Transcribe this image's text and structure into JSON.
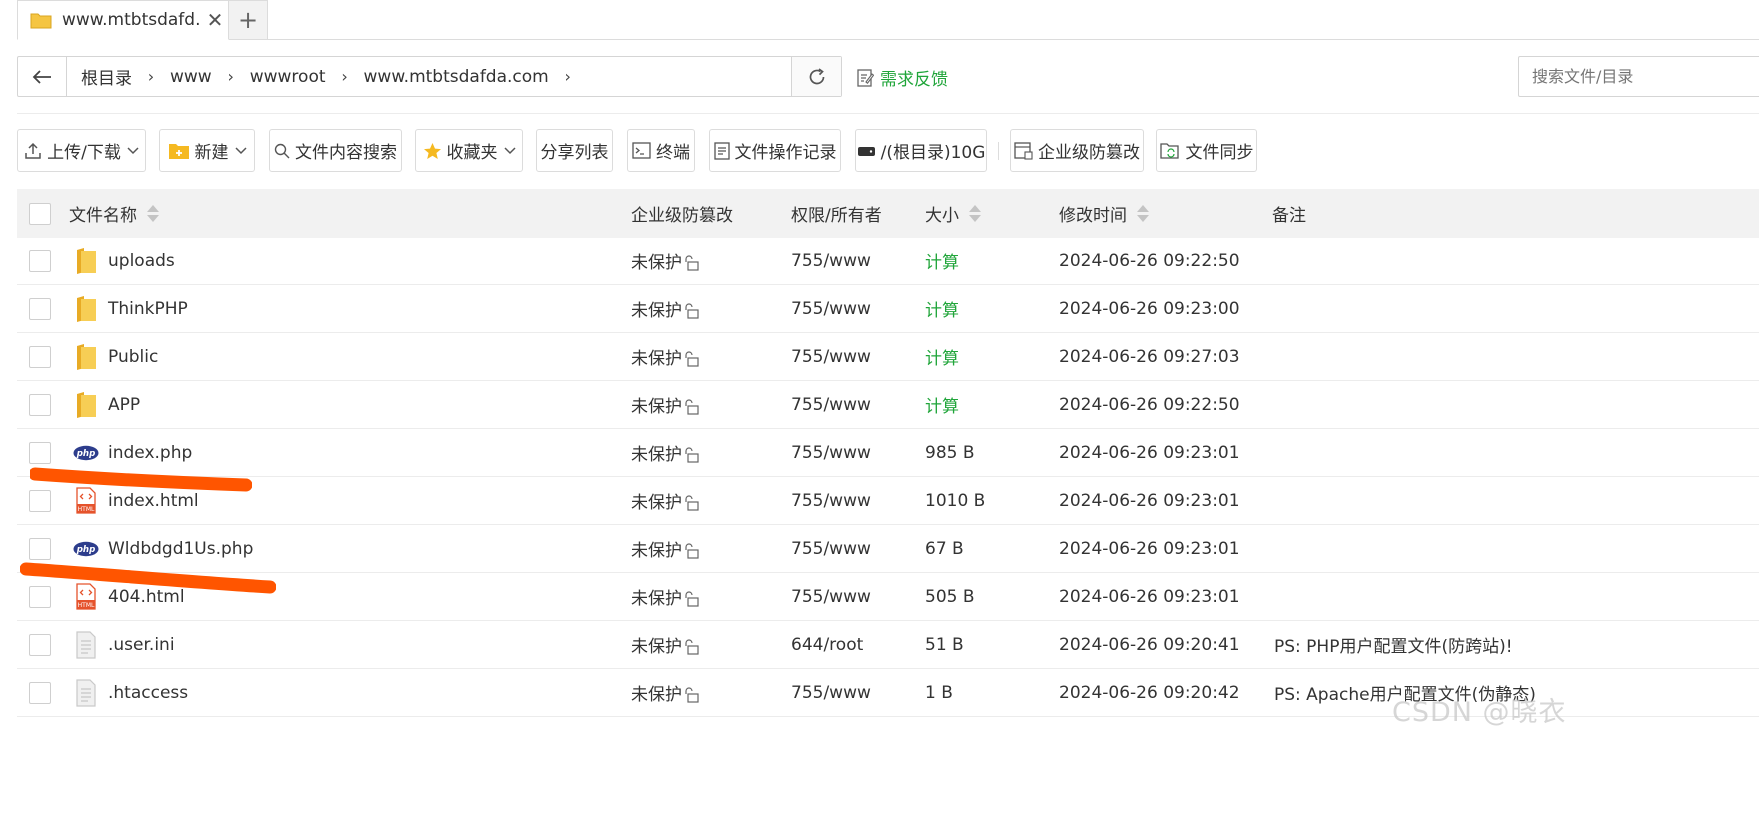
{
  "tab": {
    "title": "www.mtbtsdafd...",
    "close": "✕",
    "add": "+"
  },
  "address": {
    "crumbs": [
      "根目录",
      "www",
      "wwwroot",
      "www.mtbtsdafda.com"
    ],
    "separator": "›"
  },
  "feedback": {
    "label": "需求反馈"
  },
  "search": {
    "placeholder": "搜索文件/目录"
  },
  "toolbar": {
    "upload": "上传/下载",
    "new": "新建",
    "content_search": "文件内容搜索",
    "favorites": "收藏夹",
    "share_list": "分享列表",
    "terminal": "终端",
    "op_log": "文件操作记录",
    "disk": "/(根目录)10G",
    "tamper": "企业级防篡改",
    "sync": "文件同步"
  },
  "table": {
    "headers": {
      "name": "文件名称",
      "tamper": "企业级防篡改",
      "perm": "权限/所有者",
      "size": "大小",
      "mtime": "修改时间",
      "note": "备注"
    },
    "rows": [
      {
        "type": "folder",
        "name": "uploads",
        "protect": "未保护",
        "perm": "755/www",
        "size": "计算",
        "mtime": "2024-06-26 09:22:50",
        "note": ""
      },
      {
        "type": "folder",
        "name": "ThinkPHP",
        "protect": "未保护",
        "perm": "755/www",
        "size": "计算",
        "mtime": "2024-06-26 09:23:00",
        "note": ""
      },
      {
        "type": "folder",
        "name": "Public",
        "protect": "未保护",
        "perm": "755/www",
        "size": "计算",
        "mtime": "2024-06-26 09:27:03",
        "note": ""
      },
      {
        "type": "folder",
        "name": "APP",
        "protect": "未保护",
        "perm": "755/www",
        "size": "计算",
        "mtime": "2024-06-26 09:22:50",
        "note": ""
      },
      {
        "type": "php",
        "name": "index.php",
        "protect": "未保护",
        "perm": "755/www",
        "size": "985 B",
        "mtime": "2024-06-26 09:23:01",
        "note": ""
      },
      {
        "type": "html",
        "name": "index.html",
        "protect": "未保护",
        "perm": "755/www",
        "size": "1010 B",
        "mtime": "2024-06-26 09:23:01",
        "note": ""
      },
      {
        "type": "php",
        "name": "Wldbdgd1Us.php",
        "protect": "未保护",
        "perm": "755/www",
        "size": "67 B",
        "mtime": "2024-06-26 09:23:01",
        "note": ""
      },
      {
        "type": "html",
        "name": "404.html",
        "protect": "未保护",
        "perm": "755/www",
        "size": "505 B",
        "mtime": "2024-06-26 09:23:01",
        "note": ""
      },
      {
        "type": "text",
        "name": ".user.ini",
        "protect": "未保护",
        "perm": "644/root",
        "size": "51 B",
        "mtime": "2024-06-26 09:20:41",
        "note": "PS: PHP用户配置文件(防跨站)!"
      },
      {
        "type": "text",
        "name": ".htaccess",
        "protect": "未保护",
        "perm": "755/www",
        "size": "1 B",
        "mtime": "2024-06-26 09:20:42",
        "note": "PS: Apache用户配置文件(伪静态)"
      }
    ]
  },
  "watermark": "CSDN @晓衣",
  "colors": {
    "accent": "#20a53a",
    "annotation": "#ff5500",
    "php_badge": "#2d3d8c",
    "html_badge": "#e5532c",
    "folder": "#f5c542"
  }
}
